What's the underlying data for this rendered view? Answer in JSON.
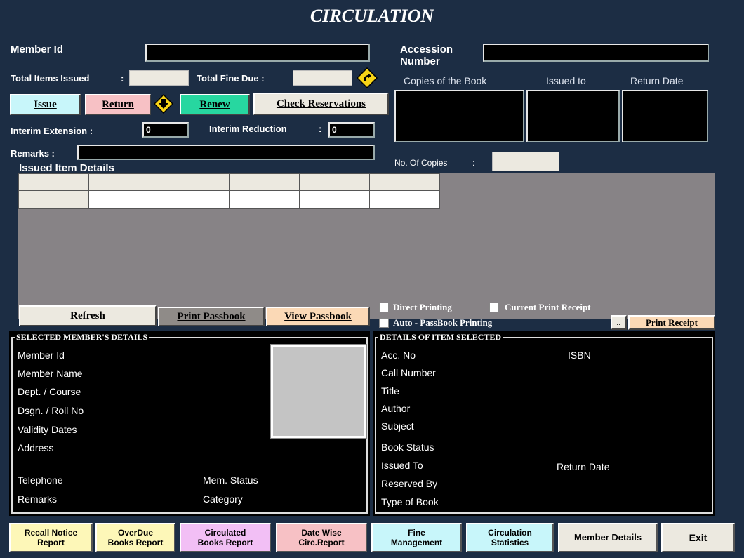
{
  "title": "CIRCULATION",
  "member_id": {
    "label": "Member Id",
    "value": ""
  },
  "accession": {
    "label_line1": "Accession",
    "label_line2": "Number",
    "value": ""
  },
  "total_items": {
    "label": "Total Items Issued",
    "colon": ":",
    "value": ""
  },
  "total_fine": {
    "label": "Total Fine Due :",
    "value": ""
  },
  "copies_headers": {
    "copies": "Copies of the Book",
    "issued_to": "Issued to",
    "return_date": "Return Date"
  },
  "buttons": {
    "issue": "Issue",
    "return": "Return",
    "renew": "Renew",
    "check_reservations": "Check Reservations",
    "refresh": "Refresh",
    "print_passbook": "Print Passbook",
    "view_passbook": "View Passbook",
    "dots": "..",
    "print_receipt": "Print Receipt"
  },
  "interim_extension": {
    "label": "Interim Extension :",
    "value": "0"
  },
  "interim_reduction": {
    "label": "Interim  Reduction",
    "colon": ":",
    "value": "0"
  },
  "remarks": {
    "label": "Remarks  :",
    "value": ""
  },
  "no_of_copies": {
    "label": "No. Of Copies",
    "colon": ":",
    "value": ""
  },
  "issued_items": {
    "label": "Issued Item Details"
  },
  "options": {
    "direct_printing": "Direct Printing",
    "current_print_receipt": "Current Print Receipt",
    "auto_passbook": "Auto - PassBook Printing"
  },
  "member_panel": {
    "legend": "SELECTED MEMBER'S DETAILS",
    "member_id": "Member Id",
    "member_name": "Member Name",
    "dept": "Dept. / Course",
    "dsgn": "Dsgn. / Roll No",
    "validity": "Validity Dates",
    "address": "Address",
    "telephone": "Telephone",
    "mem_status": "Mem. Status",
    "remarks": "Remarks",
    "category": "Category"
  },
  "item_panel": {
    "legend": "DETAILS OF ITEM SELECTED",
    "acc_no": "Acc. No",
    "isbn": "ISBN",
    "call_number": "Call Number",
    "title": "Title",
    "author": "Author",
    "subject": "Subject",
    "book_status": "Book Status",
    "issued_to": "Issued To",
    "return_date": "Return Date",
    "reserved_by": "Reserved By",
    "type_of_book": "Type of Book"
  },
  "bottom_buttons": {
    "recall_l1": "Recall Notice",
    "recall_l2": "Report",
    "overdue_l1": "OverDue",
    "overdue_l2": "Books Report",
    "circulated_l1": "Circulated",
    "circulated_l2": "Books Report",
    "datewise_l1": "Date Wise",
    "datewise_l2": "Circ.Report",
    "fine_l1": "Fine",
    "fine_l2": "Management",
    "stats_l1": "Circulation",
    "stats_l2": "Statistics",
    "member_details": "Member Details",
    "exit": "Exit"
  },
  "colors": {
    "background": "#1c2d44",
    "issue": "#c8f6fa",
    "return": "#f7c1c5",
    "renew": "#27d7a0",
    "neutral": "#ece9e0",
    "grid": "#878386",
    "recall": "#fdf7b8",
    "overdue": "#fdf7b8",
    "circulated": "#f2bff5",
    "datewise": "#f7c1c5",
    "fine": "#c8f6fa",
    "stats": "#c8f6fa",
    "print_receipt": "#fbd9b6"
  }
}
